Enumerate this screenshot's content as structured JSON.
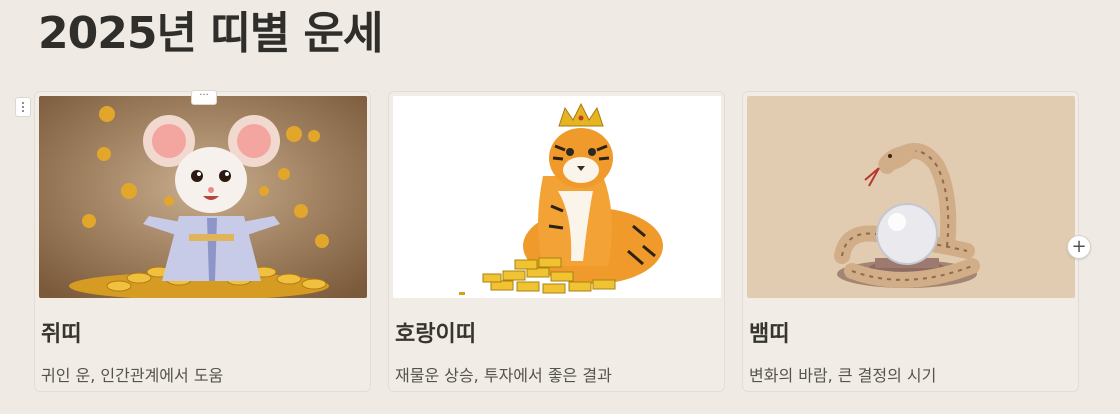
{
  "page": {
    "title": "2025년 띠별 운세"
  },
  "controls": {
    "card_menu": "···",
    "add_card": "+"
  },
  "cards": [
    {
      "name": "쥐띠",
      "description": "귀인 운, 인간관계에서 도움",
      "image_icon": "rat-with-gold-coins"
    },
    {
      "name": "호랑이띠",
      "description": "재물운 상승, 투자에서 좋은 결과",
      "image_icon": "tiger-with-crown-gold-bars"
    },
    {
      "name": "뱀띠",
      "description": "변화의 바람, 큰 결정의 시기",
      "image_icon": "snake-with-crystal-ball"
    }
  ],
  "colors": {
    "background": "#efebe4",
    "card_background": "#f1ede6",
    "title_text": "#2f2e2b"
  }
}
